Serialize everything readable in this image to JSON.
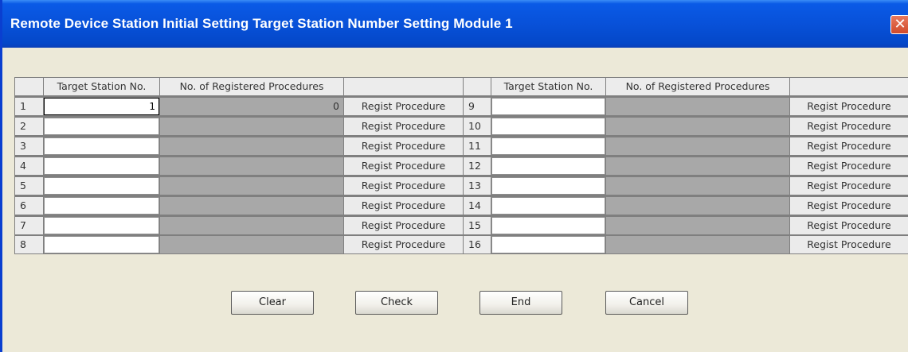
{
  "window": {
    "title": "Remote Device Station Initial Setting Target Station Number Setting Module 1",
    "close_label": "✕"
  },
  "table": {
    "headers": {
      "target_station": "Target Station No.",
      "registered_procedures": "No. of Registered Procedures"
    },
    "regist_label": "Regist Procedure",
    "left_rows": [
      {
        "no": "1",
        "station": "1",
        "count": "0"
      },
      {
        "no": "2",
        "station": "",
        "count": ""
      },
      {
        "no": "3",
        "station": "",
        "count": ""
      },
      {
        "no": "4",
        "station": "",
        "count": ""
      },
      {
        "no": "5",
        "station": "",
        "count": ""
      },
      {
        "no": "6",
        "station": "",
        "count": ""
      },
      {
        "no": "7",
        "station": "",
        "count": ""
      },
      {
        "no": "8",
        "station": "",
        "count": ""
      }
    ],
    "right_rows": [
      {
        "no": "9",
        "station": "",
        "count": ""
      },
      {
        "no": "10",
        "station": "",
        "count": ""
      },
      {
        "no": "11",
        "station": "",
        "count": ""
      },
      {
        "no": "12",
        "station": "",
        "count": ""
      },
      {
        "no": "13",
        "station": "",
        "count": ""
      },
      {
        "no": "14",
        "station": "",
        "count": ""
      },
      {
        "no": "15",
        "station": "",
        "count": ""
      },
      {
        "no": "16",
        "station": "",
        "count": ""
      }
    ]
  },
  "buttons": {
    "clear": "Clear",
    "check": "Check",
    "end": "End",
    "cancel": "Cancel"
  },
  "colors": {
    "titlebar": "#0851d9",
    "window_bg": "#ece9d8",
    "count_cell": "#a8a8a8",
    "close_button": "#d04a2a"
  }
}
